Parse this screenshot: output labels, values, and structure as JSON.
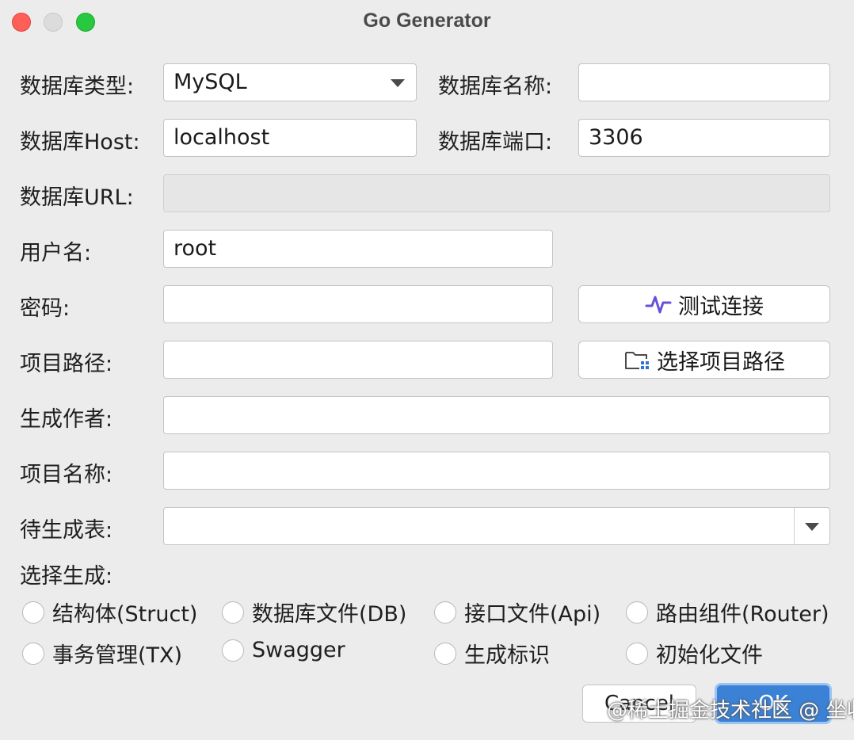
{
  "window": {
    "title": "Go Generator"
  },
  "form": {
    "db_type_label": "数据库类型:",
    "db_type_value": "MySQL",
    "db_name_label": "数据库名称:",
    "db_name_value": "",
    "db_host_label": "数据库Host:",
    "db_host_value": "localhost",
    "db_port_label": "数据库端口:",
    "db_port_value": "3306",
    "db_url_label": "数据库URL:",
    "db_url_value": "",
    "username_label": "用户名:",
    "username_value": "root",
    "password_label": "密码:",
    "password_value": "",
    "test_conn_label": "测试连接",
    "project_path_label": "项目路径:",
    "project_path_value": "",
    "choose_path_label": "选择项目路径",
    "author_label": "生成作者:",
    "author_value": "",
    "project_name_label": "项目名称:",
    "project_name_value": "",
    "tables_label": "待生成表:",
    "tables_value": "",
    "generate_label": "选择生成:"
  },
  "options": [
    {
      "label": "结构体(Struct)"
    },
    {
      "label": "数据库文件(DB)"
    },
    {
      "label": "接口文件(Api)"
    },
    {
      "label": "路由组件(Router)"
    },
    {
      "label": "事务管理(TX)"
    },
    {
      "label": "Swagger"
    },
    {
      "label": "生成标识"
    },
    {
      "label": "初始化文件"
    }
  ],
  "footer": {
    "cancel_label": "Cancel",
    "ok_label": "OK",
    "watermark": "@稀土掘金技术社区 @ 坐收日落"
  },
  "colors": {
    "accent": "#3b82d6",
    "pulse_icon": "#6b4fd8",
    "folder_icon_dots": "#2f74d0"
  }
}
